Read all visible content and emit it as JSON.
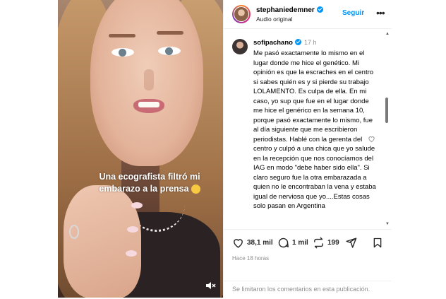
{
  "header": {
    "username": "stephaniedemner",
    "subtitle": "Audio original",
    "follow_label": "Seguir",
    "more_label": "•••"
  },
  "video": {
    "caption_line1": "Una ecografista filtró mi",
    "caption_line2": "embarazo a la prensa",
    "emoji": "smirk-emoji",
    "mute_icon": "speaker-muted-icon"
  },
  "comment": {
    "username": "sofipachano",
    "time": "17 h",
    "text": "Me pasó exactamente lo mismo en el lugar donde me hice el genético. Mi opinión es que la escraches en el centro si sabes quién es y si pierde su trabajo LOLAMENTO. Es culpa de ella. En mi caso, yo sup que fue en el lugar donde me hice el genérico en la semana 10, porque pasó exactamente lo mismo, fue al día siguiente que me escribieron periodistas. Hablé con la gerenta del centro y culpó a una chica que yo salude en la recepción que nos conocíamos del IAG en modo \"debe haber sido ella\". Si claro seguro fue la otra embarazada a quien no le encontraban la vena y estaba igual de nerviosa que yo....Estas cosas solo pasan en Argentina"
  },
  "actions": {
    "likes": "38,1 mil",
    "comments": "1 mil",
    "reposts": "199",
    "posted": "Hace 18 horas"
  },
  "footer": {
    "comments_disabled": "Se limitaron los comentarios en esta publicación."
  },
  "colors": {
    "accent": "#0095f6",
    "muted_text": "#8e8e8e",
    "divider": "#efefef"
  }
}
